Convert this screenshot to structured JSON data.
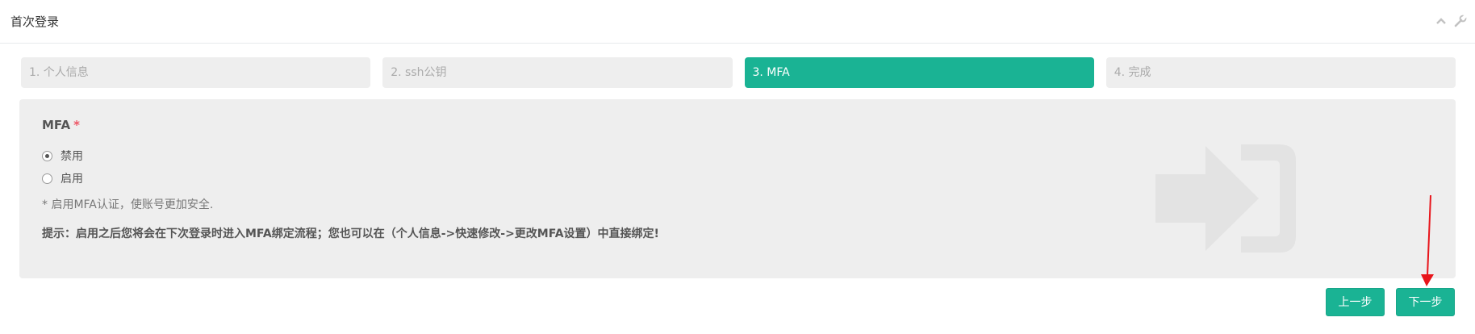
{
  "header": {
    "title": "首次登录"
  },
  "steps": [
    {
      "label": "1. 个人信息"
    },
    {
      "label": "2. ssh公钥"
    },
    {
      "label": "3. MFA"
    },
    {
      "label": "4. 完成"
    }
  ],
  "form": {
    "field_label": "MFA",
    "required_mark": "*",
    "options": [
      {
        "label": "禁用",
        "selected": true
      },
      {
        "label": "启用",
        "selected": false
      }
    ],
    "help_text": "* 启用MFA认证，使账号更加安全.",
    "hint_text": "提示：启用之后您将会在下次登录时进入MFA绑定流程；您也可以在（个人信息->快速修改->更改MFA设置）中直接绑定!"
  },
  "buttons": {
    "prev_label": "上一步",
    "next_label": "下一步"
  },
  "colors": {
    "accent": "#1ab394",
    "annotation": "#e8151b"
  }
}
